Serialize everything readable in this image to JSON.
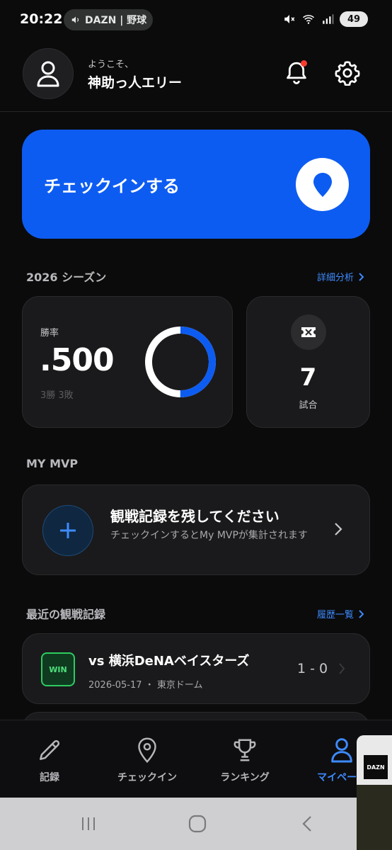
{
  "status_bar": {
    "time": "20:22",
    "media_text": "DAZN | 野球",
    "battery": "49",
    "icons": [
      "mute-icon",
      "wifi-icon",
      "signal-icon",
      "battery-icon"
    ]
  },
  "header": {
    "welcome": "ようこそ、",
    "username": "神助っ人エリー",
    "notification_dot": true
  },
  "checkin": {
    "label": "チェックインする",
    "accent": "#0d5cf2"
  },
  "season": {
    "title": "2026 シーズン",
    "link": "詳細分析",
    "winrate_label": "勝率",
    "winrate_value": ".500",
    "record": "3勝 3敗",
    "win_fraction": 0.5,
    "games_value": "7",
    "games_label": "試合"
  },
  "mvp": {
    "section_title": "MY MVP",
    "title": "観戦記録を残してください",
    "description": "チェックインするとMy MVPが集計されます"
  },
  "recent": {
    "section_title": "最近の観戦記録",
    "link": "履歴一覧",
    "games": [
      {
        "badge": "WIN",
        "title": "vs 横浜DeNAベイスターズ",
        "date": "2026-05-17",
        "venue": "東京ドーム",
        "score": "1 - 0"
      }
    ]
  },
  "bottom_nav": {
    "items": [
      {
        "label": "記録",
        "icon": "pencil-icon",
        "active": false
      },
      {
        "label": "チェックイン",
        "icon": "location-pin-icon",
        "active": false
      },
      {
        "label": "ランキング",
        "icon": "trophy-icon",
        "active": false
      },
      {
        "label": "マイページ",
        "icon": "person-icon",
        "active": true
      }
    ]
  },
  "overlay": {
    "logo": "DAZN"
  },
  "colors": {
    "background": "#0b0b0c",
    "card": "#1a1a1c",
    "accent_blue": "#3d8bff",
    "win_green": "#2ecc60"
  }
}
